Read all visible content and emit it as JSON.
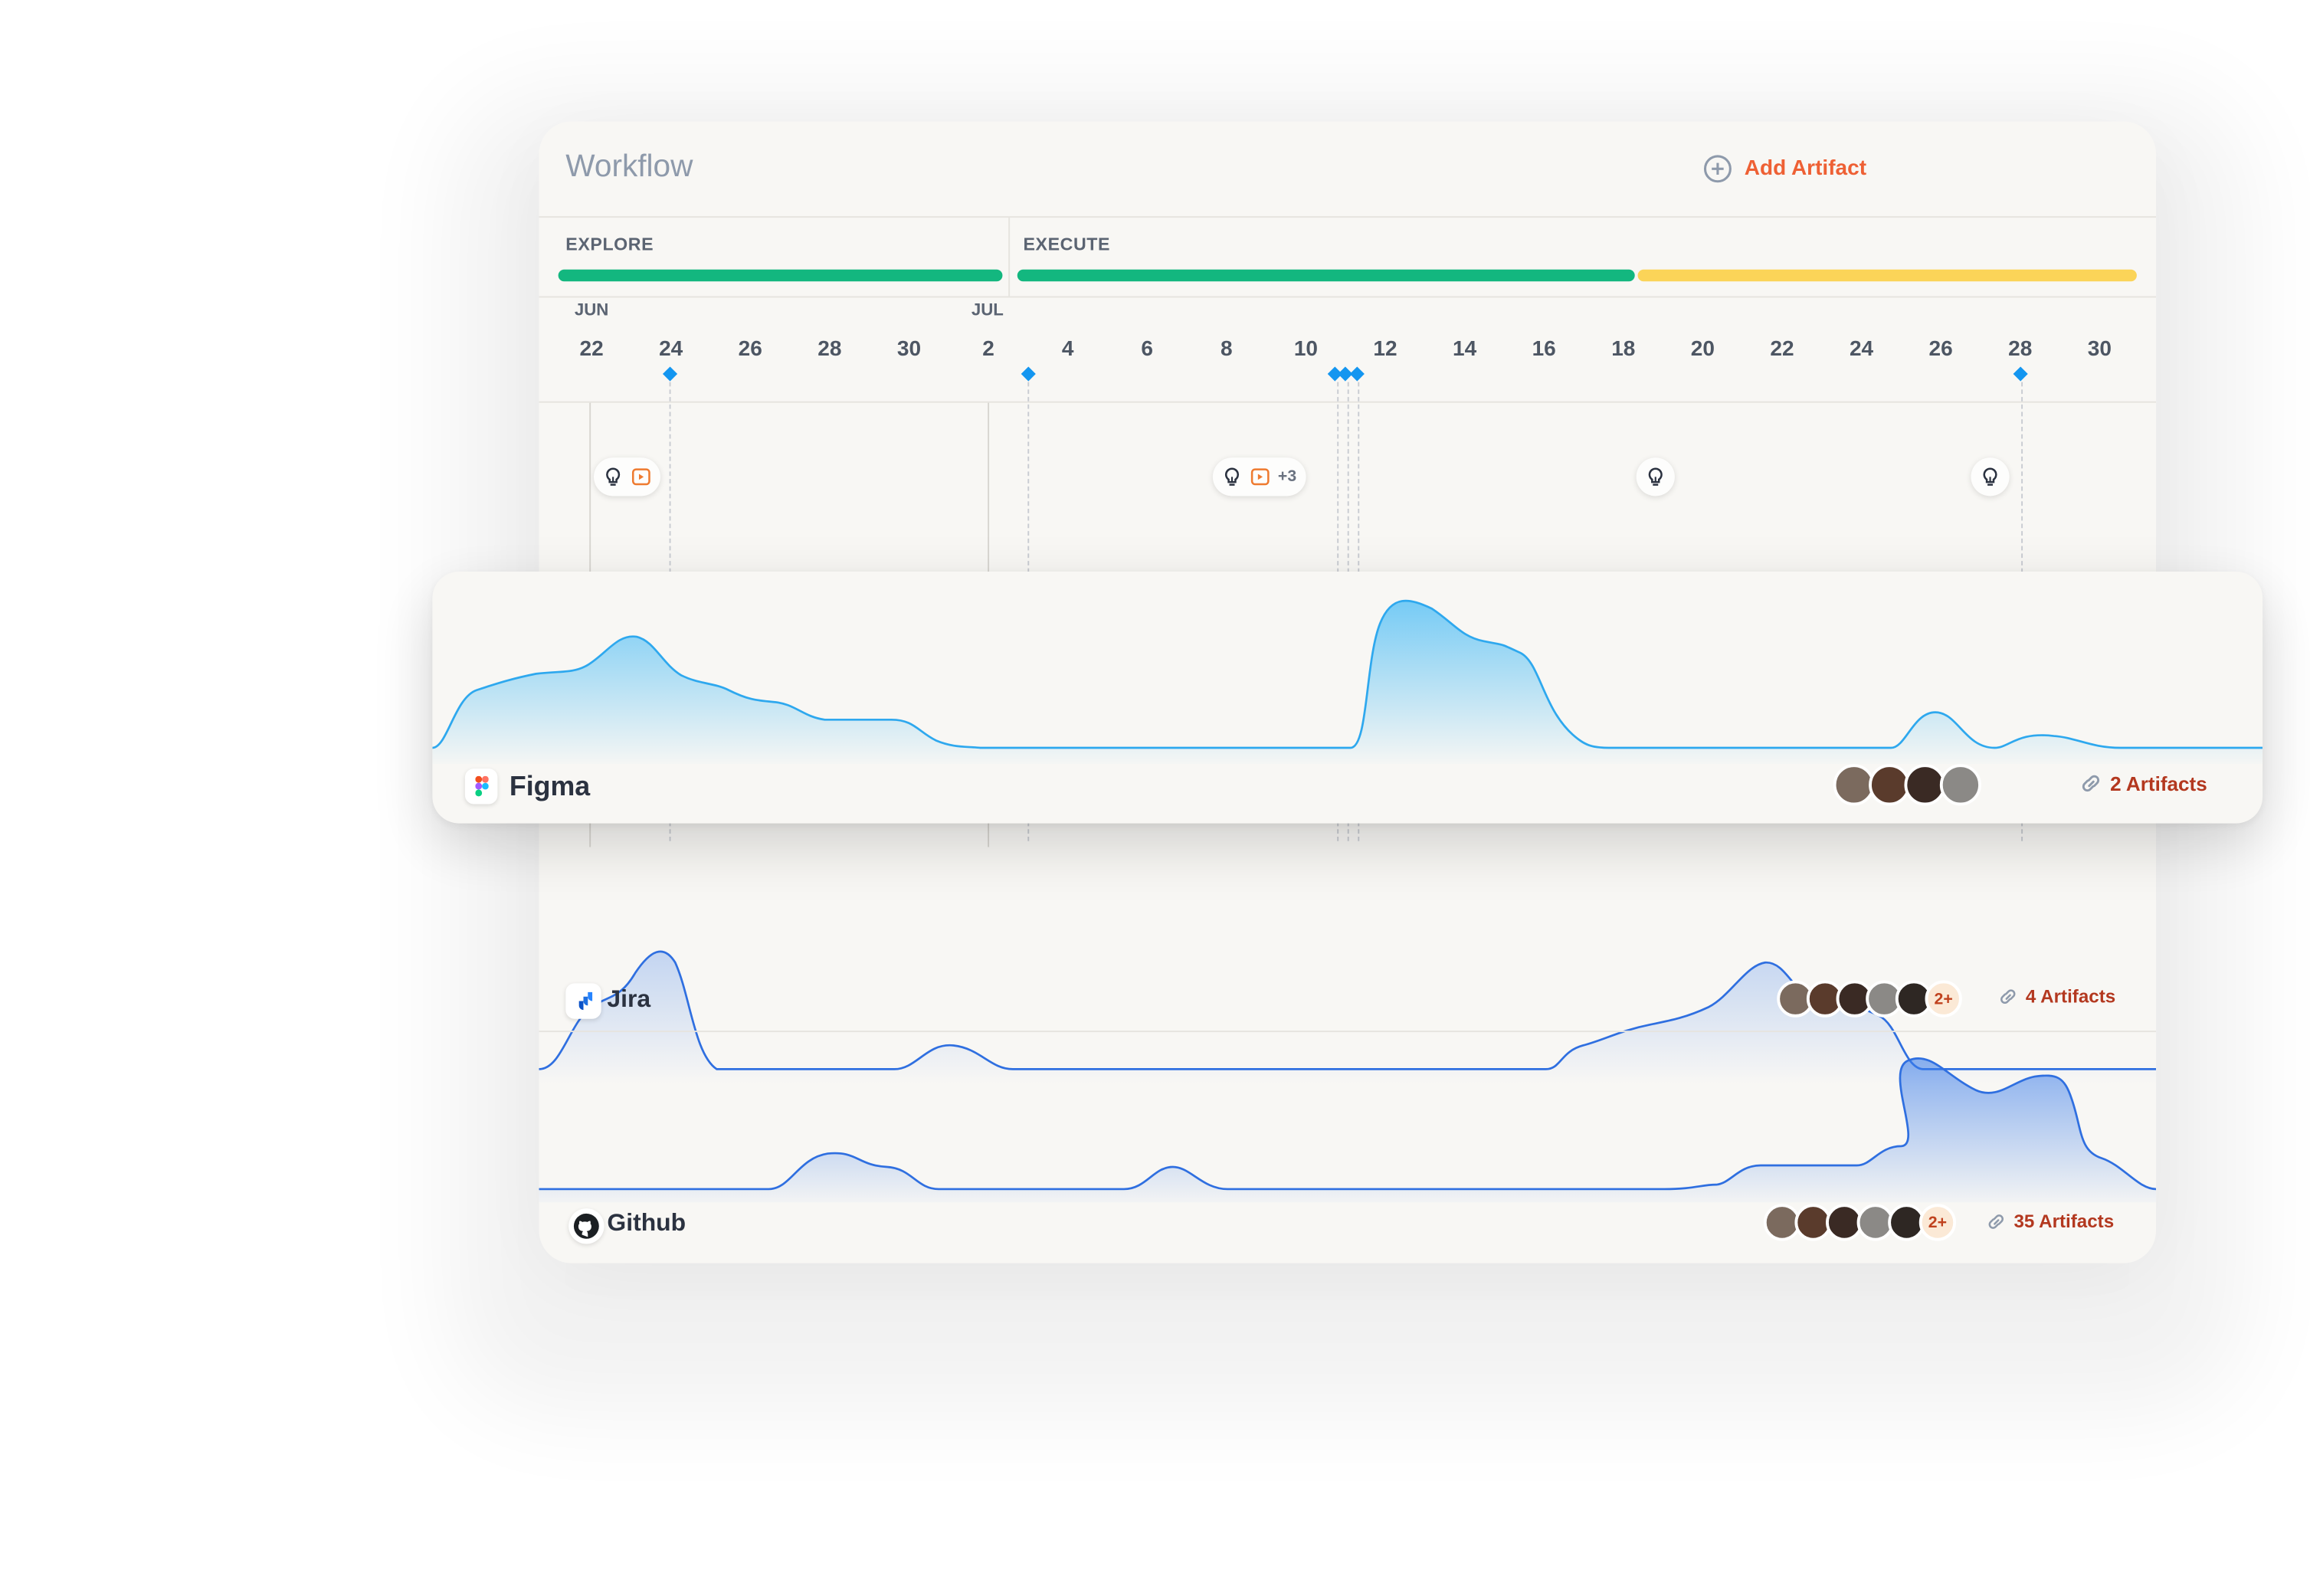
{
  "header": {
    "title": "Workflow",
    "add_label": "Add Artifact"
  },
  "phases": [
    {
      "label": "EXPLORE"
    },
    {
      "label": "EXECUTE"
    }
  ],
  "timeline": {
    "months": [
      "JUN",
      "JUL"
    ],
    "days": [
      "22",
      "24",
      "26",
      "28",
      "30",
      "2",
      "4",
      "6",
      "8",
      "10",
      "12",
      "14",
      "16",
      "18",
      "20",
      "22",
      "24",
      "26",
      "28",
      "30"
    ]
  },
  "markers": {
    "more_label": "+3"
  },
  "tools": [
    {
      "name": "Figma",
      "artifacts": "2 Artifacts",
      "extra": ""
    },
    {
      "name": "Jira",
      "artifacts": "4 Artifacts",
      "extra": "2+"
    },
    {
      "name": "Github",
      "artifacts": "35 Artifacts",
      "extra": "2+"
    }
  ],
  "colors": {
    "accent": "#ee6034",
    "phase_green": "#13b77f",
    "phase_yellow": "#fbd458",
    "milestone": "#1496f0",
    "link_red": "#b3381f"
  }
}
